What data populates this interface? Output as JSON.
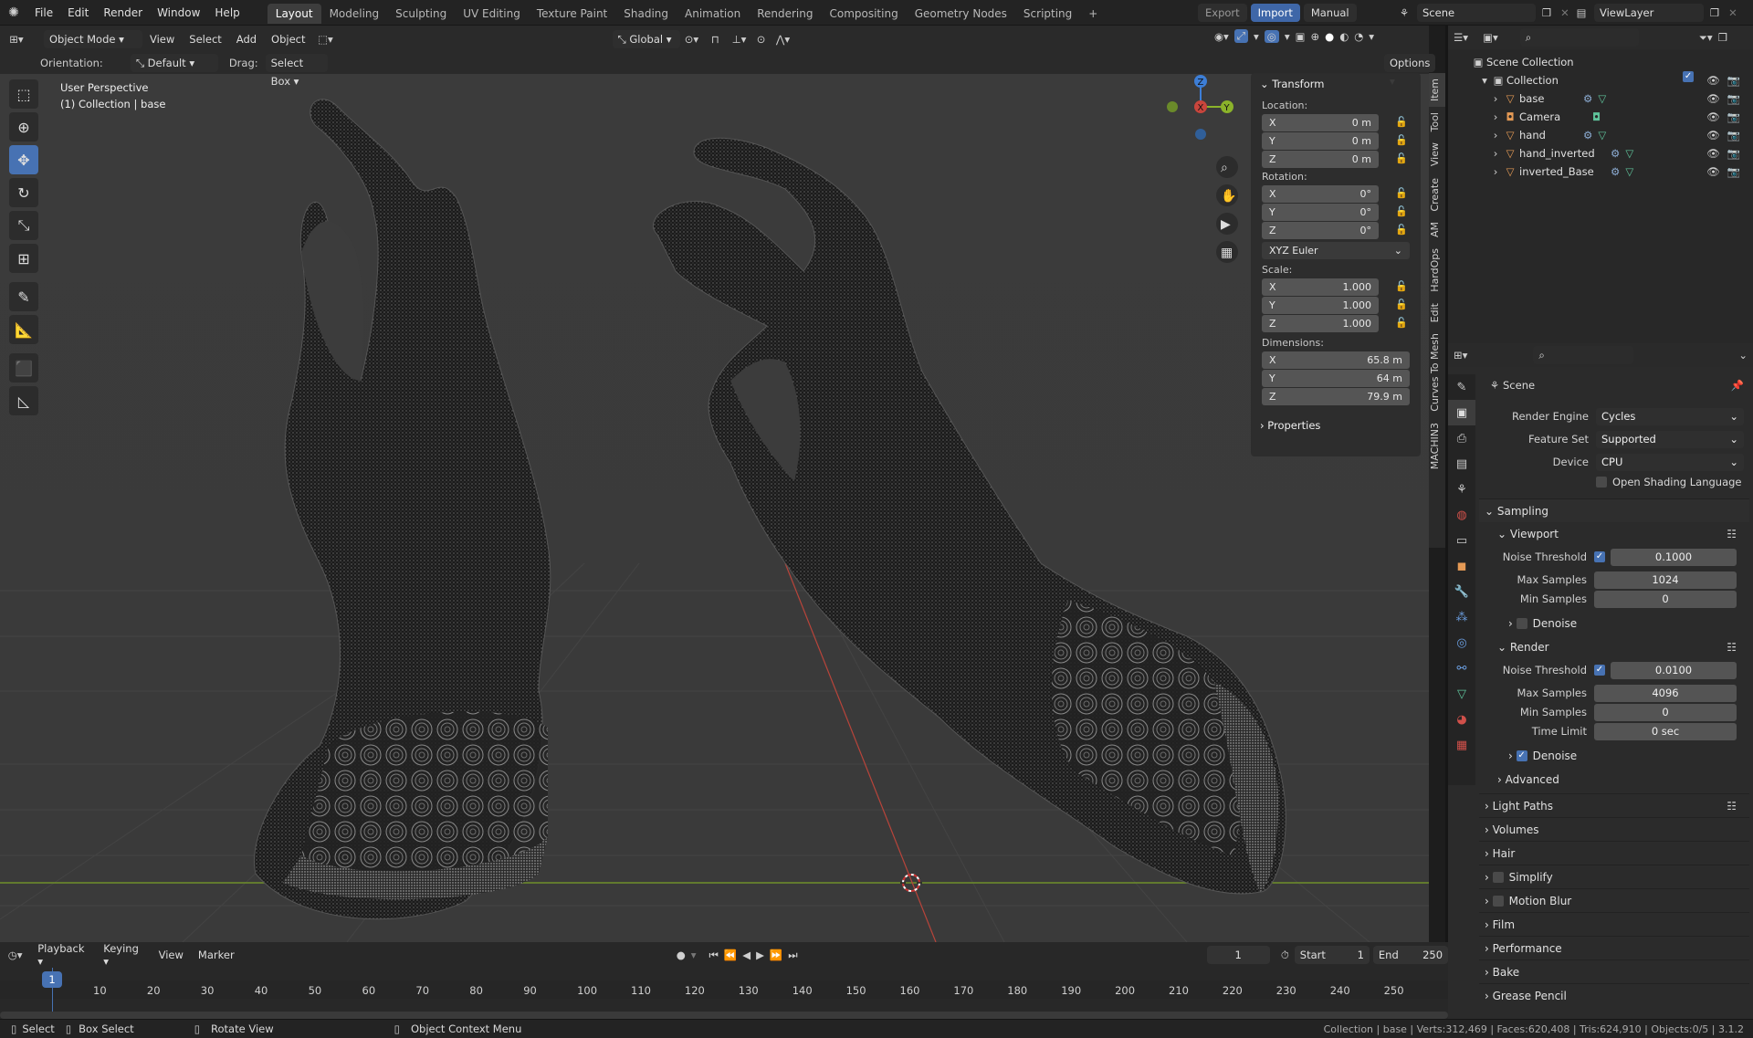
{
  "menus": [
    "File",
    "Edit",
    "Render",
    "Window",
    "Help"
  ],
  "workspaces": [
    "Layout",
    "Modeling",
    "Sculpting",
    "UV Editing",
    "Texture Paint",
    "Shading",
    "Animation",
    "Rendering",
    "Compositing",
    "Geometry Nodes",
    "Scripting"
  ],
  "topbar": {
    "export": "Export",
    "import": "Import",
    "manual": "Manual",
    "scene": "Scene",
    "view_layer": "ViewLayer"
  },
  "viewport_header": {
    "mode": "Object Mode",
    "view": "View",
    "select": "Select",
    "add": "Add",
    "object": "Object",
    "transform": "Global",
    "options": "Options"
  },
  "viewport_sub": {
    "orientation_label": "Orientation:",
    "orientation": "Default",
    "drag_label": "Drag:",
    "drag": "Select Box"
  },
  "overlay": {
    "line1": "User Perspective",
    "line2": "(1) Collection | base"
  },
  "npanel": {
    "title": "Transform",
    "location_label": "Location:",
    "location": [
      {
        "axis": "X",
        "value": "0 m"
      },
      {
        "axis": "Y",
        "value": "0 m"
      },
      {
        "axis": "Z",
        "value": "0 m"
      }
    ],
    "rotation_label": "Rotation:",
    "rotation": [
      {
        "axis": "X",
        "value": "0°"
      },
      {
        "axis": "Y",
        "value": "0°"
      },
      {
        "axis": "Z",
        "value": "0°"
      }
    ],
    "rotation_mode": "XYZ Euler",
    "scale_label": "Scale:",
    "scale": [
      {
        "axis": "X",
        "value": "1.000"
      },
      {
        "axis": "Y",
        "value": "1.000"
      },
      {
        "axis": "Z",
        "value": "1.000"
      }
    ],
    "dimensions_label": "Dimensions:",
    "dimensions": [
      {
        "axis": "X",
        "value": "65.8 m"
      },
      {
        "axis": "Y",
        "value": "64 m"
      },
      {
        "axis": "Z",
        "value": "79.9 m"
      }
    ],
    "properties": "Properties"
  },
  "side_tabs": [
    "Item",
    "Tool",
    "View",
    "Create",
    "AM",
    "HardOps",
    "Edit",
    "Curves To Mesh",
    "MACHIN3"
  ],
  "outliner": {
    "root": "Scene Collection",
    "collection": "Collection",
    "items": [
      "base",
      "Camera",
      "hand",
      "hand_inverted",
      "inverted_Base"
    ]
  },
  "properties": {
    "scene": "Scene",
    "render_engine_label": "Render Engine",
    "render_engine": "Cycles",
    "feature_set_label": "Feature Set",
    "feature_set": "Supported",
    "device_label": "Device",
    "device": "CPU",
    "osl": "Open Shading Language",
    "sampling": "Sampling",
    "viewport": "Viewport",
    "noise_threshold_label": "Noise Threshold",
    "vp_noise": "0.1000",
    "max_samples_label": "Max Samples",
    "vp_max": "1024",
    "min_samples_label": "Min Samples",
    "vp_min": "0",
    "denoise": "Denoise",
    "render": "Render",
    "r_noise": "0.0100",
    "r_max": "4096",
    "r_min": "0",
    "time_limit_label": "Time Limit",
    "time_limit": "0 sec",
    "advanced": "Advanced",
    "sections": [
      "Light Paths",
      "Volumes",
      "Hair",
      "Simplify",
      "Motion Blur",
      "Film",
      "Performance",
      "Bake",
      "Grease Pencil"
    ]
  },
  "timeline": {
    "playback": "Playback",
    "keying": "Keying",
    "view": "View",
    "marker": "Marker",
    "current_frame": "1",
    "start_label": "Start",
    "start": "1",
    "end_label": "End",
    "end": "250",
    "ticks": [
      "1",
      "10",
      "20",
      "30",
      "40",
      "50",
      "60",
      "70",
      "80",
      "90",
      "100",
      "110",
      "120",
      "130",
      "140",
      "150",
      "160",
      "170",
      "180",
      "190",
      "200",
      "210",
      "220",
      "230",
      "240",
      "250"
    ]
  },
  "status": {
    "select": "Select",
    "box_select": "Box Select",
    "rotate_view": "Rotate View",
    "context_menu": "Object Context Menu",
    "stats": "Collection | base | Verts:312,469 | Faces:620,408 | Tris:624,910 | Objects:0/5 | 3.1.2"
  },
  "colors": {
    "accent": "#4772b3",
    "x_axis": "#c8453c",
    "y_axis": "#8bb32a",
    "z_axis": "#3d7ed6",
    "grid": "#464646"
  }
}
